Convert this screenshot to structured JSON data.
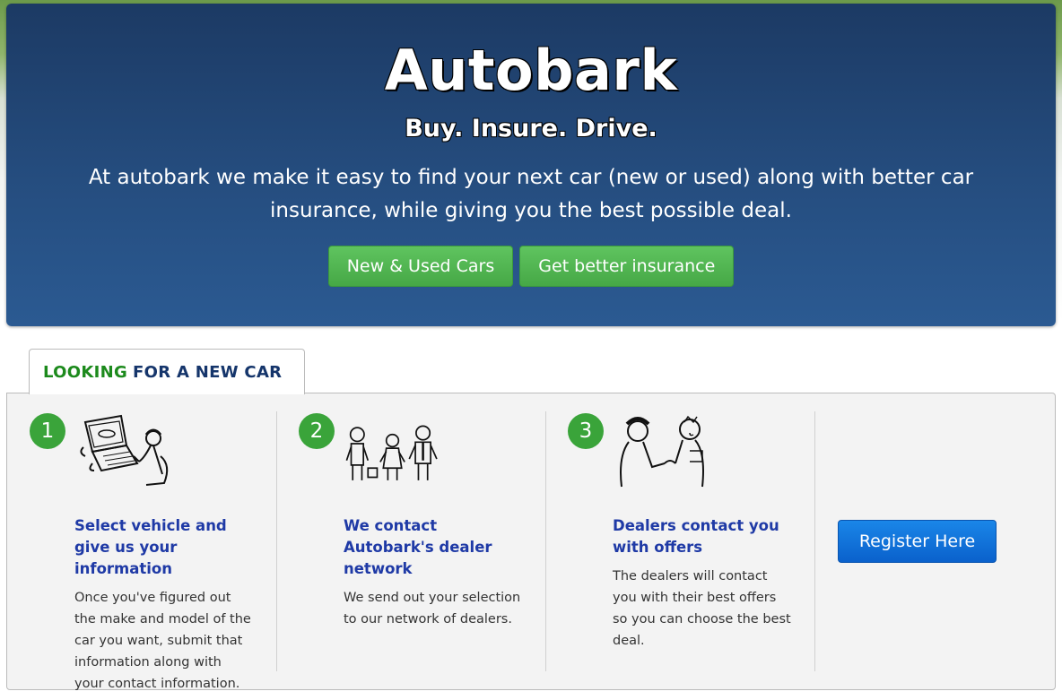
{
  "hero": {
    "title": "Autobark",
    "tagline": "Buy. Insure. Drive.",
    "intro": "At autobark we make it easy to find your next car (new or used) along with better car insurance, while giving you the best possible deal.",
    "buttons": [
      "New & Used Cars",
      "Get better insurance"
    ]
  },
  "tab": {
    "label_highlight": "LOOKING",
    "label_rest": "FOR A NEW CAR"
  },
  "steps": [
    {
      "number": "1",
      "title": "Select vehicle and give us your information",
      "body": "Once you've figured out the make and model of the car you want, submit that information along with your contact information."
    },
    {
      "number": "2",
      "title": "We contact Autobark's dealer network",
      "body": "We send out your selection to our network of dealers."
    },
    {
      "number": "3",
      "title": "Dealers contact you with offers",
      "body": "The dealers will contact you with their best offers so you can choose the best deal."
    }
  ],
  "register_label": "Register Here",
  "colors": {
    "hero_bg": "#254d7f",
    "green_button": "#4cae4c",
    "badge_green": "#3aa43a",
    "heading_blue": "#1f3aa6",
    "register_blue": "#0e6fd8"
  },
  "icons": {
    "step1": "person-at-computer-illustration",
    "step2": "family-group-illustration",
    "step3": "handshake-illustration"
  }
}
